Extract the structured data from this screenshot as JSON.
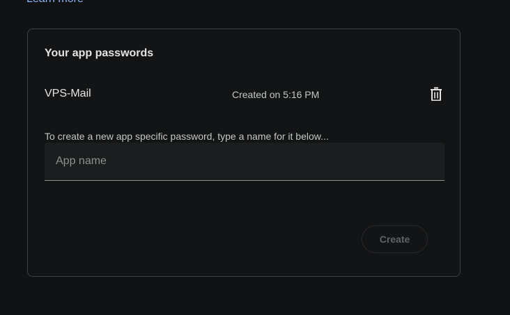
{
  "header": {
    "learn_more_link": "Learn more"
  },
  "card": {
    "title": "Your app passwords",
    "passwords": [
      {
        "name": "VPS-Mail",
        "created": "Created on 5:16 PM",
        "delete_icon": "trash-icon"
      }
    ],
    "hint": "To create a new app specific password, type a name for it below...",
    "app_name_input": {
      "value": "",
      "placeholder": "App name"
    },
    "create_button": {
      "label": "Create",
      "enabled": false
    }
  },
  "colors": {
    "background": "#111214",
    "card_border": "#3c4043",
    "link": "#8ab4f8",
    "text_primary": "#e3e3e3",
    "text_secondary": "#c4c7c5",
    "disabled": "#5f6368"
  }
}
